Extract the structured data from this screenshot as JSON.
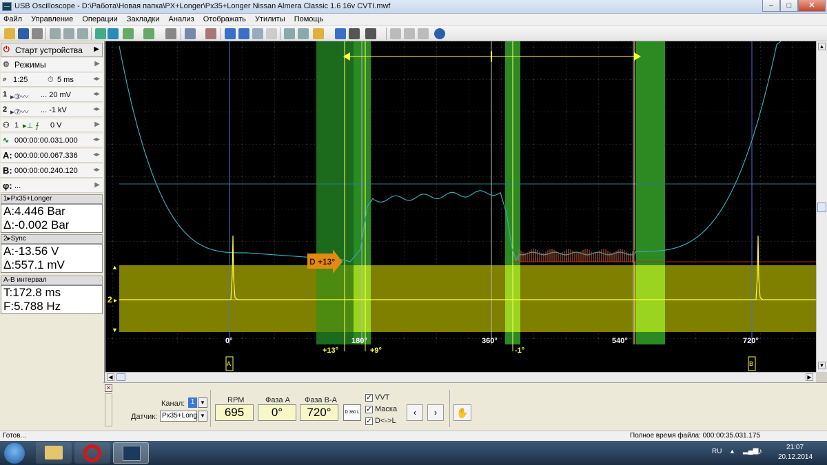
{
  "window": {
    "title": "USB Oscilloscope - D:\\Работа\\Новая папка\\PX+Longer\\Px35+Longer Nissan Almera Classic 1.6 16v CVTI.mwf",
    "minimize": "–",
    "maximize": "□",
    "close": "✕"
  },
  "menu": [
    "Файл",
    "Управление",
    "Операции",
    "Закладки",
    "Анализ",
    "Отображать",
    "Утилиты",
    "Помощь"
  ],
  "left": {
    "start_label": "Старт устройства",
    "modes_label": "Режимы",
    "zoom": "1:25",
    "timebase": "5 ms",
    "ch1_num": "1",
    "ch1_range": "... 20 mV",
    "ch2_num": "2",
    "ch2_range": "... -1 kV",
    "trigger_ch": "1",
    "trigger_level": "0 V",
    "time_offset": "000:00:00.031.000",
    "cursor_a_label": "A:",
    "cursor_a_time": "000:00:00.067.336",
    "cursor_b_label": "B:",
    "cursor_b_time": "000:00:00.240.120",
    "phi_label": "φ:",
    "phi_value": "...",
    "ch1_header": "1▸Px35+Longer",
    "ch1_a": "A:4.446 Bar",
    "ch1_delta": "Δ:-0.002 Bar",
    "ch2_header": "2▸Sync",
    "ch2_a": "A:-13.56 V",
    "ch2_delta": "Δ:557.1 mV",
    "ab_header": "А-В интервал",
    "ab_t": "T:172.8 ms",
    "ab_f": "F:5.788 Hz"
  },
  "scope": {
    "marker_label": "D +13°",
    "ch2_marker": "2",
    "deg_labels": [
      "0°",
      "180°",
      "360°",
      "540°",
      "720°"
    ],
    "offset_labels": [
      "+13°",
      "+9°",
      "-1°"
    ],
    "cursor_a": "A",
    "cursor_b": "B"
  },
  "bottom": {
    "channel_label": "Канал:",
    "channel_value": "1",
    "sensor_label": "Датчик:",
    "sensor_value": "Px35+Longer",
    "rpm_label": "RPM",
    "rpm_value": "695",
    "phase_a_label": "Фаза А",
    "phase_a_value": "0°",
    "phase_ba_label": "Фаза В-А",
    "phase_ba_value": "720°",
    "vvt_label": "VVT",
    "mask_label": "Маска",
    "dl_label": "D<->L",
    "btn_text": "D 360 L"
  },
  "status": {
    "left": "Готов...",
    "right": "Полное время файла: 000:00:35.031.175"
  },
  "taskbar": {
    "lang": "RU",
    "time": "21:07",
    "date": "20.12.2014"
  },
  "colors": {
    "trace_pressure": "#39a8b4",
    "trace_sync": "#ffff40",
    "band_dark": "#1c6b1c",
    "band_light": "#3aa52b",
    "ch2_zone": "#7f7f00"
  }
}
